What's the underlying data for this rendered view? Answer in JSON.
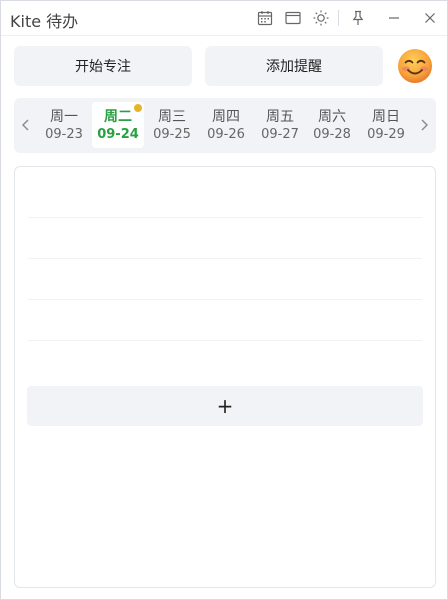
{
  "window": {
    "title": "Kite 待办"
  },
  "titlebar": {
    "icons": [
      "calendar-icon",
      "window-icon",
      "brightness-icon",
      "pin-icon",
      "minimize-icon",
      "close-icon"
    ]
  },
  "actions": {
    "focus_label": "开始专注",
    "reminder_label": "添加提醒",
    "avatar": "smiling-face-emoji"
  },
  "week": {
    "days": [
      {
        "name": "周一",
        "date": "09-23"
      },
      {
        "name": "周二",
        "date": "09-24"
      },
      {
        "name": "周三",
        "date": "09-25"
      },
      {
        "name": "周四",
        "date": "09-26"
      },
      {
        "name": "周五",
        "date": "09-27"
      },
      {
        "name": "周六",
        "date": "09-28"
      },
      {
        "name": "周日",
        "date": "09-29"
      }
    ],
    "selected": "周二",
    "dot_color": "#e8b22b",
    "active_color": "#2aa043"
  },
  "tasks": {
    "add_label": "+"
  }
}
